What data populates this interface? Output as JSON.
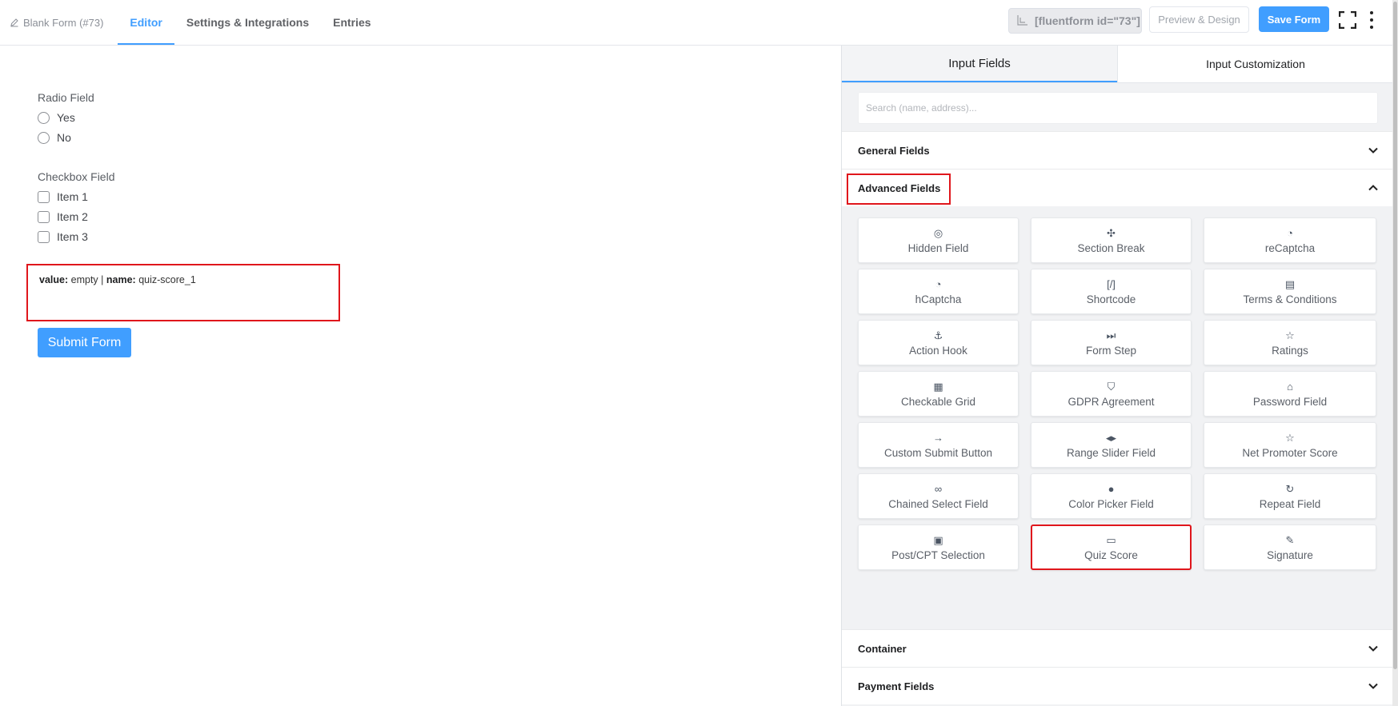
{
  "topbar": {
    "form_name": "Blank Form (#73)",
    "tabs": [
      {
        "label": "Editor",
        "active": true
      },
      {
        "label": "Settings & Integrations",
        "active": false
      },
      {
        "label": "Entries",
        "active": false
      }
    ],
    "shortcode": "[fluentform id=\"73\"]",
    "preview_label": "Preview & Design",
    "save_label": "Save Form"
  },
  "form": {
    "radio_label": "Radio Field",
    "radio_options": [
      "Yes",
      "No"
    ],
    "checkbox_label": "Checkbox Field",
    "checkbox_options": [
      "Item 1",
      "Item 2",
      "Item 3"
    ],
    "quiz": {
      "value_key": "value:",
      "value_val": "empty",
      "sep": "|",
      "name_key": "name:",
      "name_val": "quiz-score_1"
    },
    "submit_label": "Submit Form"
  },
  "panel": {
    "tabs": [
      {
        "label": "Input Fields",
        "active": true
      },
      {
        "label": "Input Customization",
        "active": false
      }
    ],
    "search_placeholder": "Search (name, address)...",
    "sections": {
      "general": "General Fields",
      "advanced": "Advanced Fields",
      "container": "Container",
      "payment": "Payment Fields"
    },
    "advanced_items": [
      {
        "label": "Hidden Field",
        "icon": "eye-slash-icon"
      },
      {
        "label": "Section Break",
        "icon": "puzzle-icon"
      },
      {
        "label": "reCaptcha",
        "icon": "recaptcha-icon"
      },
      {
        "label": "hCaptcha",
        "icon": "hcaptcha-icon"
      },
      {
        "label": "Shortcode",
        "icon": "shortcode-icon"
      },
      {
        "label": "Terms & Conditions",
        "icon": "scroll-icon"
      },
      {
        "label": "Action Hook",
        "icon": "hook-icon"
      },
      {
        "label": "Form Step",
        "icon": "step-forward-icon"
      },
      {
        "label": "Ratings",
        "icon": "star-icon"
      },
      {
        "label": "Checkable Grid",
        "icon": "grid-icon"
      },
      {
        "label": "GDPR Agreement",
        "icon": "shield-icon"
      },
      {
        "label": "Password Field",
        "icon": "lock-icon"
      },
      {
        "label": "Custom Submit Button",
        "icon": "arrow-right-icon"
      },
      {
        "label": "Range Slider Field",
        "icon": "range-icon"
      },
      {
        "label": "Net Promoter Score",
        "icon": "star-outline-icon"
      },
      {
        "label": "Chained Select Field",
        "icon": "link-icon"
      },
      {
        "label": "Color Picker Field",
        "icon": "drop-icon"
      },
      {
        "label": "Repeat Field",
        "icon": "repeat-icon"
      },
      {
        "label": "Post/CPT Selection",
        "icon": "post-icon"
      },
      {
        "label": "Quiz Score",
        "icon": "quiz-icon"
      },
      {
        "label": "Signature",
        "icon": "pen-icon"
      }
    ]
  }
}
